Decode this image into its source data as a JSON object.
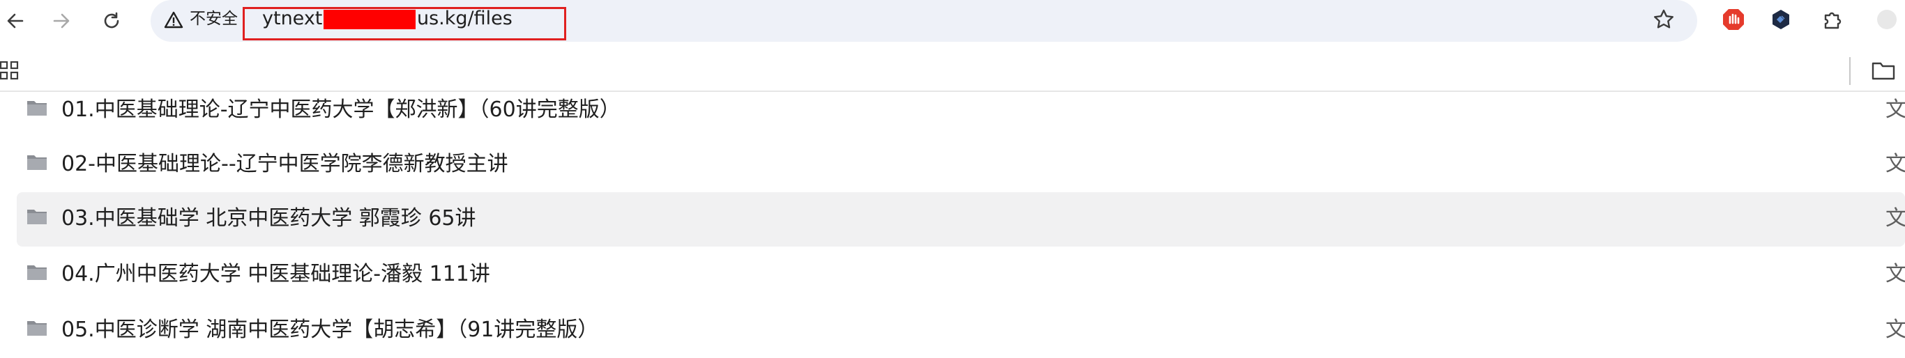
{
  "address_bar": {
    "security_label": "不安全",
    "url_prefix": "ytnext",
    "url_suffix": "us.kg/files"
  },
  "files": [
    {
      "name": "01.中医基础理论-辽宁中医药大学【郑洪新】（60讲完整版）",
      "side_label": "文"
    },
    {
      "name": "02-中医基础理论--辽宁中医学院李德新教授主讲",
      "side_label": "文"
    },
    {
      "name": "03.中医基础学 北京中医药大学 郭霞珍 65讲",
      "side_label": "文"
    },
    {
      "name": "04.广州中医药大学 中医基础理论-潘毅 111讲",
      "side_label": "文"
    },
    {
      "name": "05.中医诊断学 湖南中医药大学【胡志希】（91讲完整版）",
      "side_label": "文"
    }
  ],
  "icons": {
    "back": "arrow-left",
    "forward": "arrow-right",
    "reload": "reload",
    "warning": "warning-triangle",
    "bookmark": "star",
    "folder": "folder",
    "apps": "grid"
  },
  "colors": {
    "omnibox_bg": "#eef1f8",
    "redaction": "#ff0000",
    "highlight_box": "#e02020",
    "row_hover": "#f1f1f2"
  }
}
